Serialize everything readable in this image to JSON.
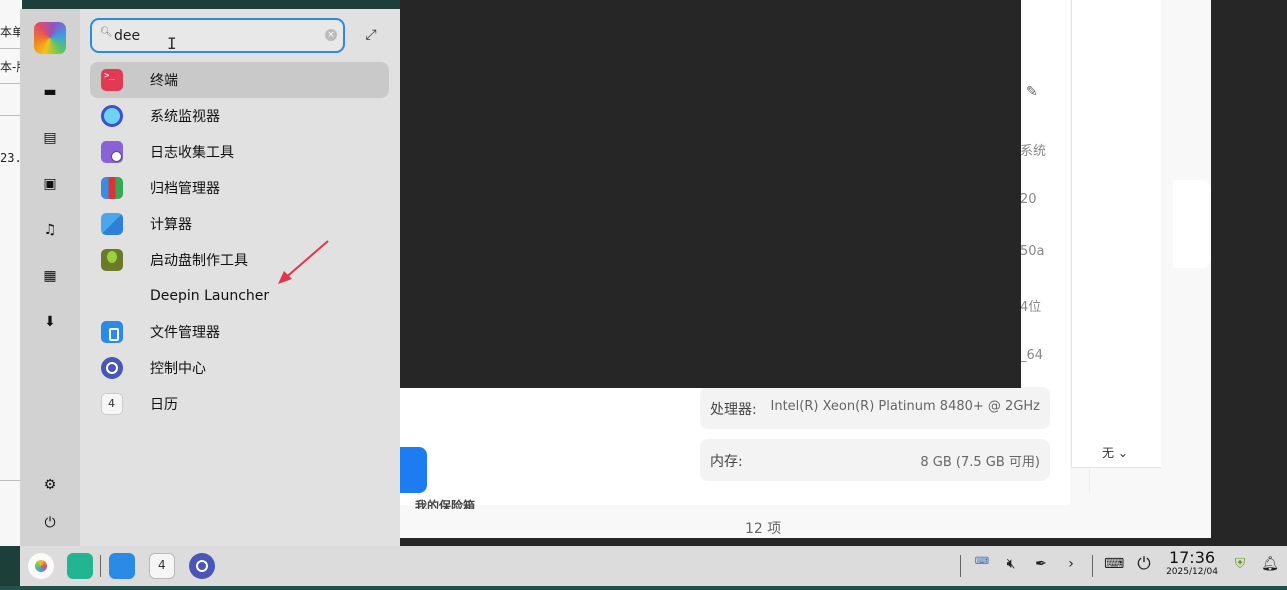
{
  "search": {
    "value": "dee"
  },
  "apps": [
    {
      "name": "终端",
      "icon": "terminal-icon"
    },
    {
      "name": "系统监视器",
      "icon": "system-monitor-icon"
    },
    {
      "name": "日志收集工具",
      "icon": "log-viewer-icon"
    },
    {
      "name": "归档管理器",
      "icon": "archive-manager-icon"
    },
    {
      "name": "计算器",
      "icon": "calculator-icon"
    },
    {
      "name": "启动盘制作工具",
      "icon": "boot-maker-icon"
    },
    {
      "name": "Deepin Launcher",
      "icon": ""
    },
    {
      "name": "文件管理器",
      "icon": "file-manager-icon"
    },
    {
      "name": "控制中心",
      "icon": "control-center-icon"
    },
    {
      "name": "日历",
      "icon": "calendar-icon"
    }
  ],
  "calendar_day": "4",
  "background": {
    "left_fragments": [
      "本单",
      "本-版",
      "23."
    ],
    "edge_values": [
      "系统",
      "20",
      "50a",
      "4位",
      "_64"
    ],
    "processor_label": "处理器:",
    "processor_value": "Intel(R) Xeon(R) Platinum 8480+ @ 2GHz",
    "memory_label": "内存:",
    "memory_value": "8 GB (7.5 GB 可用)",
    "select_value": "无",
    "cut_text": "我的保险箱",
    "item_count": "12 项"
  },
  "clock": {
    "time": "17:36",
    "date": "2025/12/04"
  },
  "colors": {
    "accent": "#2a8ae6",
    "arrow": "#e0354b"
  }
}
